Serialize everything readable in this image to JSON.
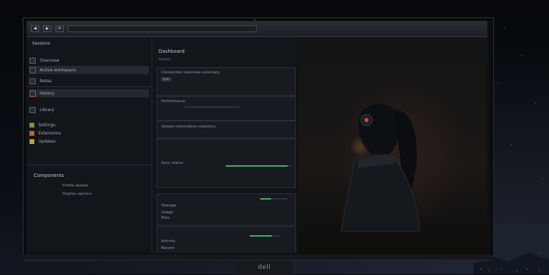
{
  "browser": {
    "address": "",
    "nav_buttons": [
      "◀",
      "▶",
      "⟳"
    ]
  },
  "window_controls": [
    "▢",
    "▢",
    "✕"
  ],
  "left_panel": {
    "header": "Sessions",
    "items": [
      {
        "label": "Overview",
        "selected": false
      },
      {
        "label": "Active workspace",
        "selected": true
      },
      {
        "label": "Notes",
        "selected": false
      },
      {
        "label": "History",
        "selected": false
      },
      {
        "label": "Library",
        "selected": false
      },
      {
        "label": "Settings",
        "selected": false
      },
      {
        "label": "Extensions",
        "selected": false
      },
      {
        "label": "Updates",
        "selected": false
      }
    ],
    "section_title": "Components",
    "section_lines": [
      "Profile details",
      "Display options"
    ]
  },
  "center_panel": {
    "title": "Dashboard",
    "subtitle": "Status",
    "cards": [
      {
        "lines": [
          "Connection overview summary",
          "Edit"
        ],
        "progress": null
      },
      {
        "lines": [
          "Performance"
        ],
        "progress": null
      },
      {
        "lines": [
          "Details information statistics"
        ],
        "progress": null
      },
      {
        "lines": [
          "Sync status"
        ],
        "progress": 0.95
      },
      {
        "lines": [
          "Storage",
          "Usage",
          "Files"
        ],
        "progress": 0.4
      },
      {
        "lines": [
          "Activity",
          "Recent"
        ],
        "progress": 0.7
      }
    ]
  },
  "monitor_brand": "dell",
  "colors": {
    "accent_green": "#3fb86b",
    "panel_bg": "#121519"
  }
}
